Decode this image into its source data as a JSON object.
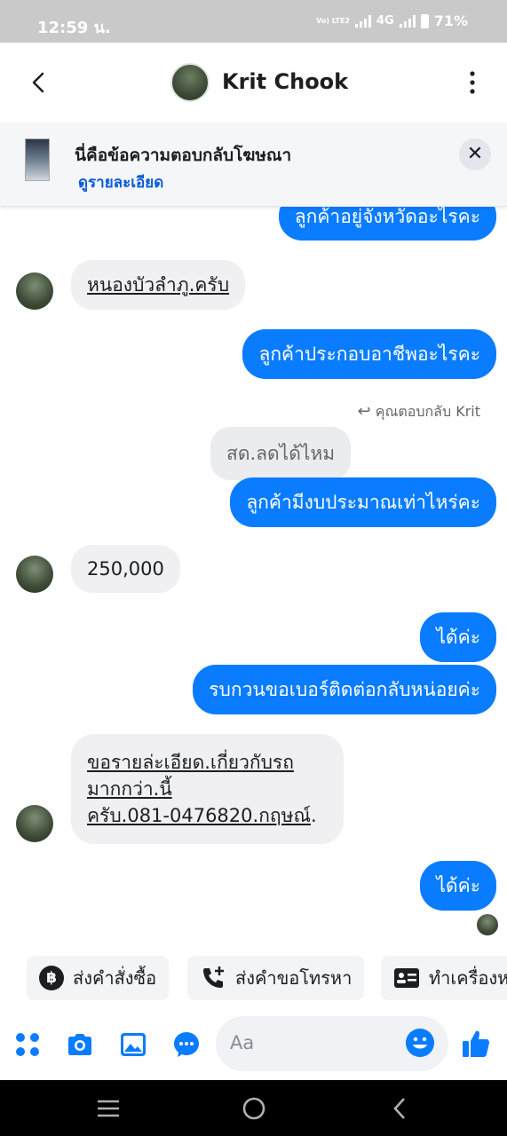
{
  "status_bar": {
    "time": "12:59 น.",
    "network_tag": "Vo) LTE2",
    "network": "4G",
    "battery": "71%"
  },
  "header": {
    "contact_name": "Krit Chook"
  },
  "ad_banner": {
    "title": "นี่คือข้อความตอบกลับโฆษณา",
    "link": "ดูรายละเอียด"
  },
  "messages": {
    "m1": "ลูกค้าอยู่จังหวัดอะไรคะ",
    "m2": "หนองบัวลำภู.ครับ",
    "m3": "ลูกค้าประกอบอาชีพอะไรคะ",
    "reply_hint": "คุณตอบกลับ Krit",
    "quoted": "สด.ลดได้ไหม",
    "m4": "ลูกค้ามีงบประมาณเท่าไหร่คะ",
    "m5": "250,000",
    "m6": "ได้ค่ะ",
    "m7": "รบกวนขอเบอร์ติดต่อกลับหน่อยค่ะ",
    "m8_line1": "ขอรายล่ะเอียด.เกี่ยวกับรถ",
    "m8_line2": "มากกว่า.นี้",
    "m8_line3a": "ครับ.081-0476820.กฤษณ์",
    "m8_line3b": ".",
    "m9": "ได้ค่ะ"
  },
  "quick_replies": [
    {
      "label": "ส่งคำสั่งซื้อ",
      "icon": "baht-icon"
    },
    {
      "label": "ส่งคำขอโทรหา",
      "icon": "phone-add-icon"
    },
    {
      "label": "ทำเครื่องห",
      "icon": "id-card-icon"
    }
  ],
  "composer": {
    "placeholder": "Aa"
  },
  "colors": {
    "accent": "#0a7cff",
    "incoming_bubble": "#f0f0f2",
    "status_bar": "#c9c9c9"
  }
}
